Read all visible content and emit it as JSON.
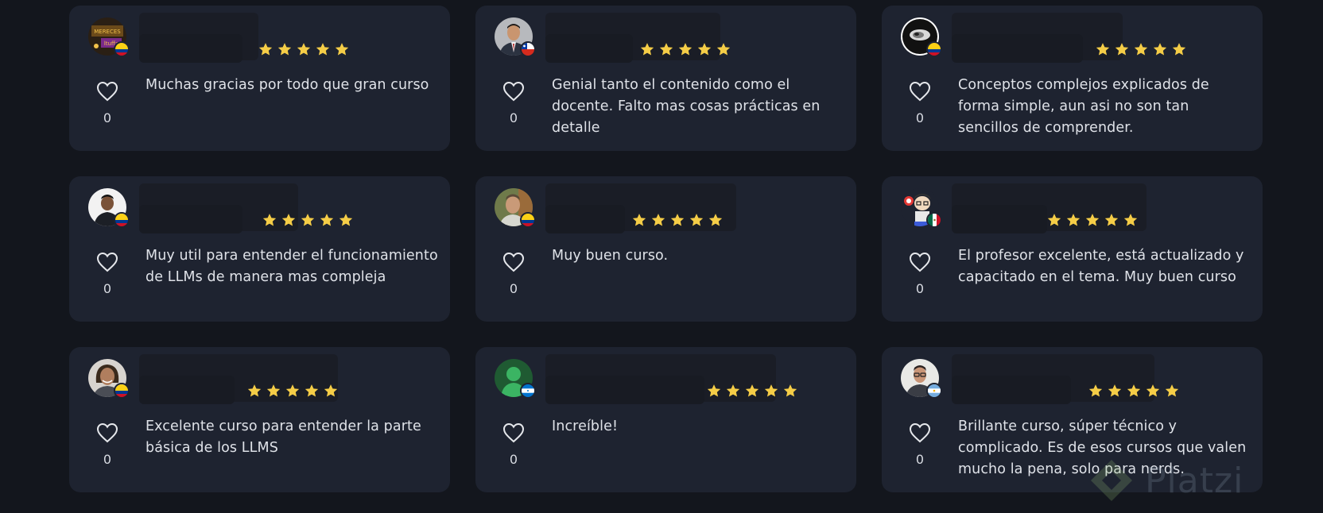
{
  "reviews": [
    {
      "comment": "Muchas gracias por todo que gran curso",
      "likes": "0",
      "rating": 5,
      "flag": "colombia",
      "avatar": "dark-poster"
    },
    {
      "comment": "Genial tanto el contenido como el docente. Falto mas cosas prácticas en detalle",
      "likes": "0",
      "rating": 5,
      "flag": "chile",
      "avatar": "man-suit"
    },
    {
      "comment": "Conceptos complejos explicados de forma simple, aun asi no son tan sencillos de comprender.",
      "likes": "0",
      "rating": 5,
      "flag": "colombia",
      "avatar": "black-white-logo"
    },
    {
      "comment": "Muy util para entender el funcionamiento de LLMs de manera mas compleja",
      "likes": "0",
      "rating": 5,
      "flag": "colombia",
      "avatar": "man-dark-shirt"
    },
    {
      "comment": "Muy buen curso.",
      "likes": "0",
      "rating": 5,
      "flag": "colombia",
      "avatar": "man-outdoors"
    },
    {
      "comment": "El profesor excelente, está actualizado y capacitado en el tema. Muy buen curso",
      "likes": "0",
      "rating": 5,
      "flag": "mexico",
      "avatar": "cartoon"
    },
    {
      "comment": "Excelente curso para entender la parte básica de los LLMS",
      "likes": "0",
      "rating": 5,
      "flag": "colombia",
      "avatar": "woman-smiling"
    },
    {
      "comment": "Increíble!",
      "likes": "0",
      "rating": 5,
      "flag": "honduras",
      "avatar": "default-green"
    },
    {
      "comment": "Brillante curso, súper técnico y complicado. Es de esos cursos que valen mucho la pena, solo para nerds.",
      "likes": "0",
      "rating": 5,
      "flag": "argentina",
      "avatar": "man-glasses"
    }
  ],
  "watermark": {
    "text": "Platzi"
  },
  "colors": {
    "background": "#13161d",
    "card": "#1e2330",
    "star": "#f5cd47",
    "text": "#dfe2e8"
  },
  "icons": {
    "like": "heart-outline-icon",
    "star": "star-icon"
  }
}
